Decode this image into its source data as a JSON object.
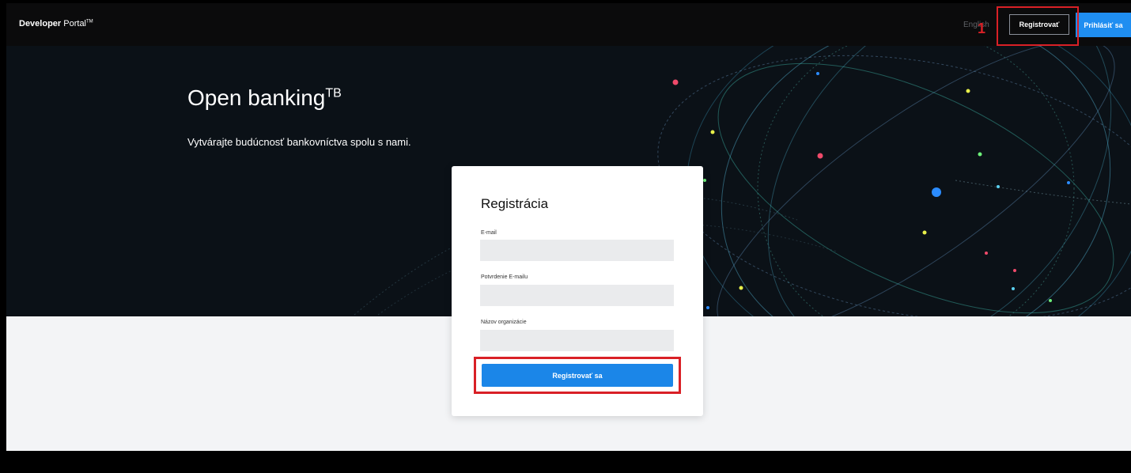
{
  "header": {
    "brand_bold": "Developer",
    "brand_rest": "Portal",
    "brand_tm": "TM",
    "language": "English",
    "register_label": "Registrovať",
    "login_label": "Prihlásiť sa"
  },
  "annotation": {
    "step_number": "1",
    "color": "#d92026"
  },
  "hero": {
    "title": "Open banking",
    "title_sup": "TB",
    "subtitle": "Vytvárajte budúcnosť bankovníctva spolu s nami."
  },
  "form": {
    "title": "Registrácia",
    "fields": [
      {
        "label": "E-mail",
        "value": ""
      },
      {
        "label": "Potvrdenie E-mailu",
        "value": ""
      },
      {
        "label": "Názov organizácie",
        "value": ""
      }
    ],
    "submit_label": "Registrovať sa"
  },
  "colors": {
    "accent": "#1f8ef1",
    "hero_bg": "#0b1117",
    "content_bg": "#f3f4f6"
  }
}
